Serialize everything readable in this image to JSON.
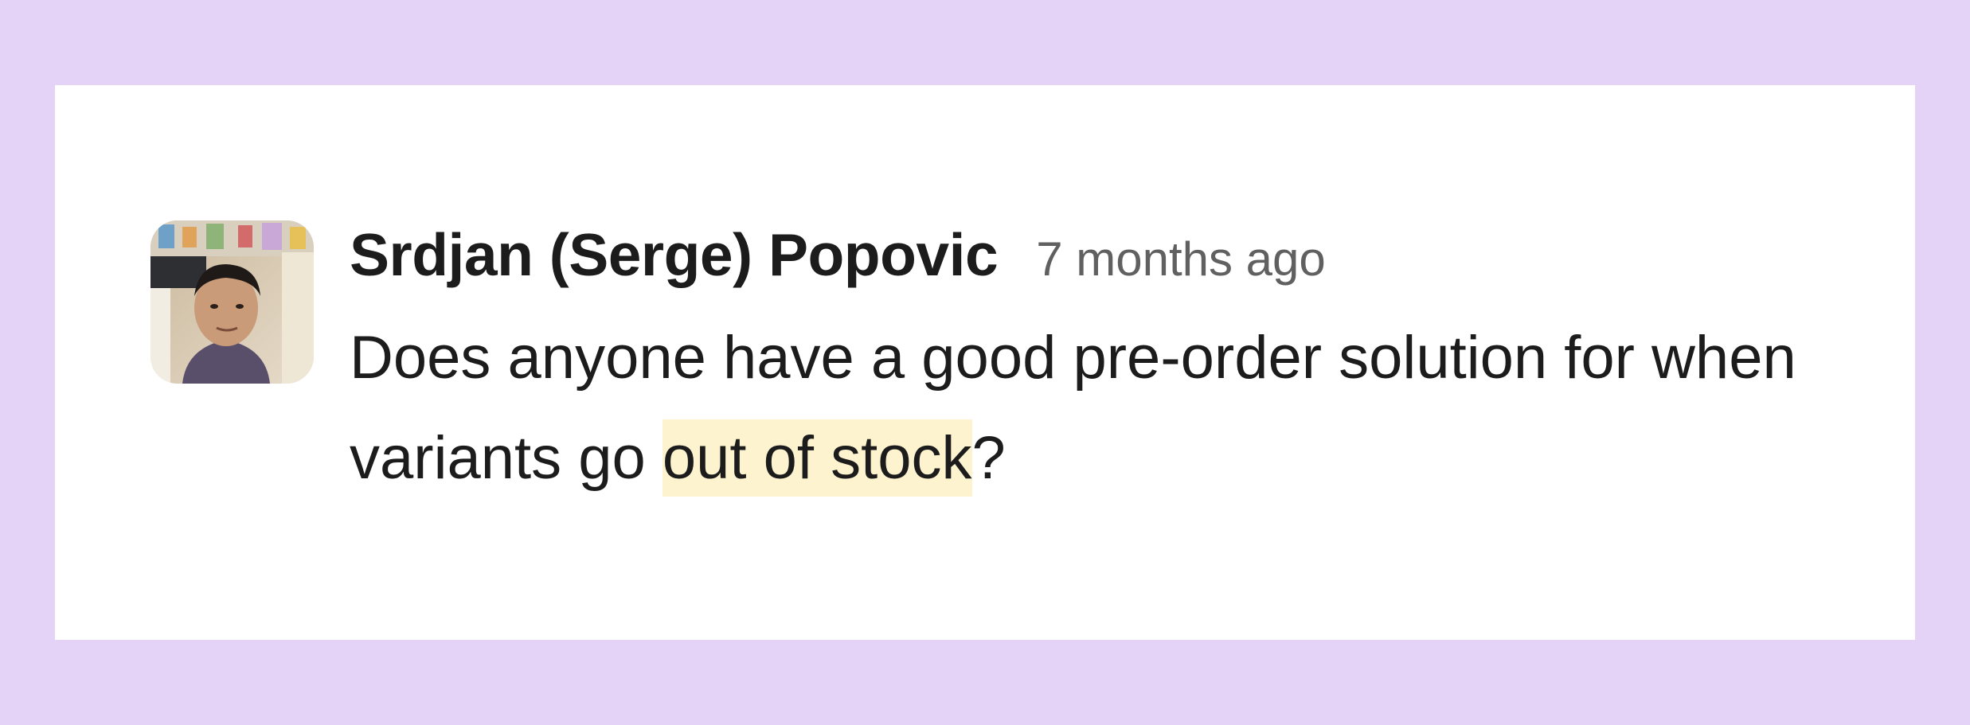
{
  "message": {
    "author": "Srdjan (Serge) Popovic",
    "timestamp": "7 months ago",
    "text_before": "Does anyone have a good pre-order solution for when variants go ",
    "highlighted_text": "out of stock",
    "text_after": "?",
    "avatar_icon": "user-avatar-photo"
  },
  "colors": {
    "page_background": "#e4d3f7",
    "card_background": "#ffffff",
    "author_text": "#1d1c1d",
    "timestamp_text": "#616061",
    "highlight": "#fdf4cf"
  }
}
